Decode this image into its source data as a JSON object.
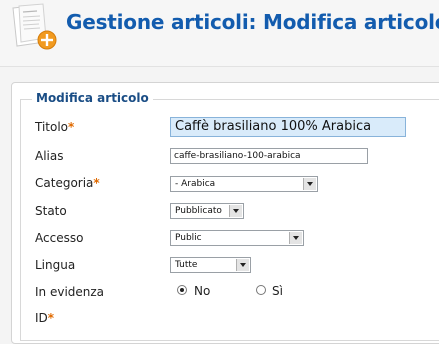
{
  "header": {
    "title": "Gestione articoli: Modifica articolo",
    "icon": "article-add-icon"
  },
  "form": {
    "legend": "Modifica articolo",
    "required_mark": "*",
    "fields": {
      "title": {
        "label": "Titolo",
        "value": "Caffè brasiliano 100% Arabica"
      },
      "alias": {
        "label": "Alias",
        "value": "caffe-brasiliano-100-arabica"
      },
      "category": {
        "label": "Categoria",
        "value": "- Arabica"
      },
      "state": {
        "label": "Stato",
        "value": "Pubblicato"
      },
      "access": {
        "label": "Accesso",
        "value": "Public"
      },
      "language": {
        "label": "Lingua",
        "value": "Tutte"
      },
      "featured": {
        "label": "In evidenza",
        "options": [
          "No",
          "Sì"
        ],
        "selected": "No"
      },
      "id": {
        "label": "ID"
      }
    }
  },
  "colors": {
    "accent": "#135cae",
    "required": "#e06a00",
    "active_input": "#d9ebfa"
  }
}
